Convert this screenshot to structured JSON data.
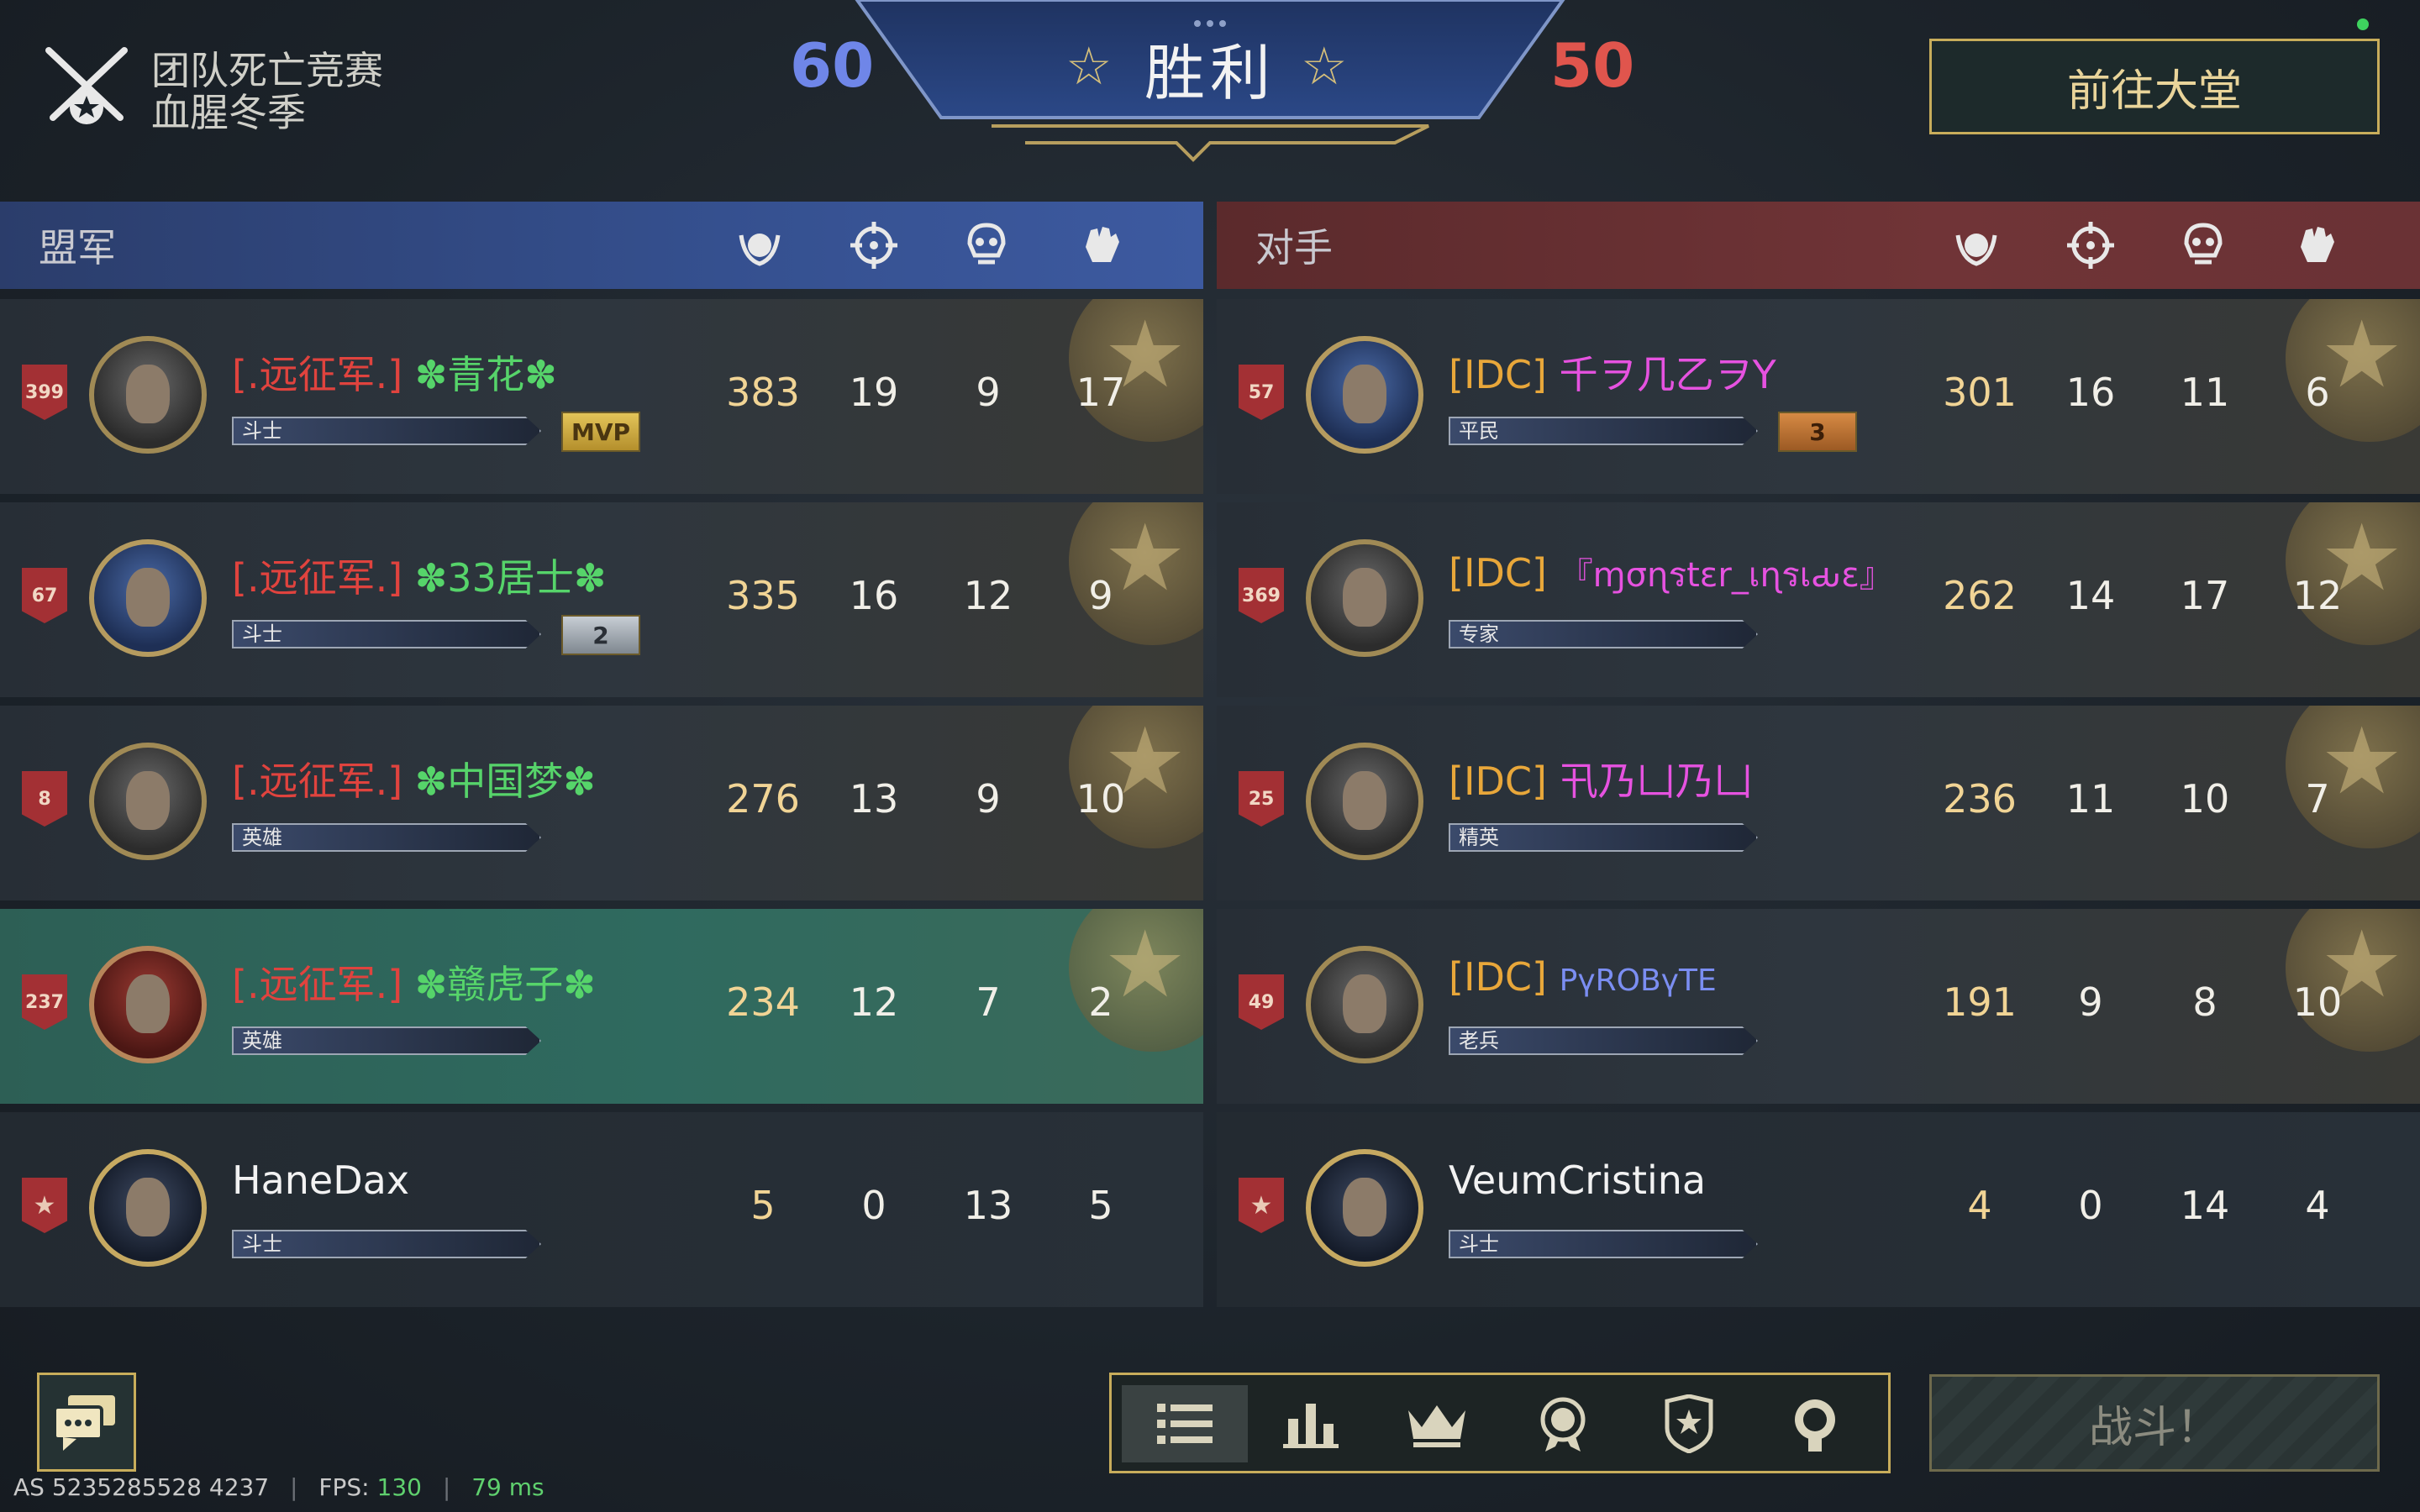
{
  "header": {
    "mode_title": "团队死亡竞赛",
    "mode_subtitle": "血腥冬季",
    "score_ally": "60",
    "score_enemy": "50",
    "result": "胜利",
    "lobby_button": "前往大堂"
  },
  "ally": {
    "label": "盟军",
    "players": [
      {
        "rank": "399",
        "clan": "[.远征军.]",
        "nick": "✽青花✽",
        "title": "斗士",
        "badge": "MVP",
        "score": "383",
        "kills": "19",
        "deaths": "9",
        "assists": "17"
      },
      {
        "rank": "67",
        "clan": "[.远征军.]",
        "nick": "✽33居士✽",
        "title": "斗士",
        "badge": "2",
        "score": "335",
        "kills": "16",
        "deaths": "12",
        "assists": "9"
      },
      {
        "rank": "8",
        "clan": "[.远征军.]",
        "nick": "✽中国梦✽",
        "title": "英雄",
        "badge": "",
        "score": "276",
        "kills": "13",
        "deaths": "9",
        "assists": "10"
      },
      {
        "rank": "237",
        "clan": "[.远征军.]",
        "nick": "✽赣虎子✽",
        "title": "英雄",
        "badge": "",
        "score": "234",
        "kills": "12",
        "deaths": "7",
        "assists": "2"
      },
      {
        "rank": "★",
        "clan": "",
        "nick": "HaneDax",
        "title": "斗士",
        "badge": "",
        "score": "5",
        "kills": "0",
        "deaths": "13",
        "assists": "5"
      }
    ]
  },
  "enemy": {
    "label": "对手",
    "players": [
      {
        "rank": "57",
        "clan": "[IDC]",
        "nick": "千ヲ几乙ヲY",
        "title": "平民",
        "badge": "3",
        "score": "301",
        "kills": "16",
        "deaths": "11",
        "assists": "6"
      },
      {
        "rank": "369",
        "clan": "[IDC]",
        "nick": "『ɱσɳรtɛr_เɳรเԃɛ』",
        "title": "专家",
        "badge": "",
        "score": "262",
        "kills": "14",
        "deaths": "17",
        "assists": "12"
      },
      {
        "rank": "25",
        "clan": "[IDC]",
        "nick": "卂乃凵乃凵",
        "title": "精英",
        "badge": "",
        "score": "236",
        "kills": "11",
        "deaths": "10",
        "assists": "7"
      },
      {
        "rank": "49",
        "clan": "[IDC]",
        "nick": "PүROBүTE",
        "title": "老兵",
        "badge": "",
        "score": "191",
        "kills": "9",
        "deaths": "8",
        "assists": "10"
      },
      {
        "rank": "★",
        "clan": "",
        "nick": "VeumCristina",
        "title": "斗士",
        "badge": "",
        "score": "4",
        "kills": "0",
        "deaths": "14",
        "assists": "4"
      }
    ]
  },
  "column_icons": [
    "score-laurel-icon",
    "crosshair-icon",
    "skull-icon",
    "fist-icon"
  ],
  "bottom": {
    "fight_button": "战斗！",
    "tab_icons": [
      "list-icon",
      "bar-chart-icon",
      "crown-icon",
      "medal-icon",
      "shield-star-icon",
      "award-icon"
    ]
  },
  "footer": {
    "server_id": "AS 5235285528 4237",
    "fps_label": "FPS:",
    "fps_value": "130",
    "ping": "79 ms"
  },
  "colors": {
    "ally_score": "#6f86e8",
    "enemy_score": "#e0554d",
    "ally_clan": "#e0433e",
    "enemy_clan": "#e8a73a",
    "gold_accent": "#c8ad5b"
  }
}
